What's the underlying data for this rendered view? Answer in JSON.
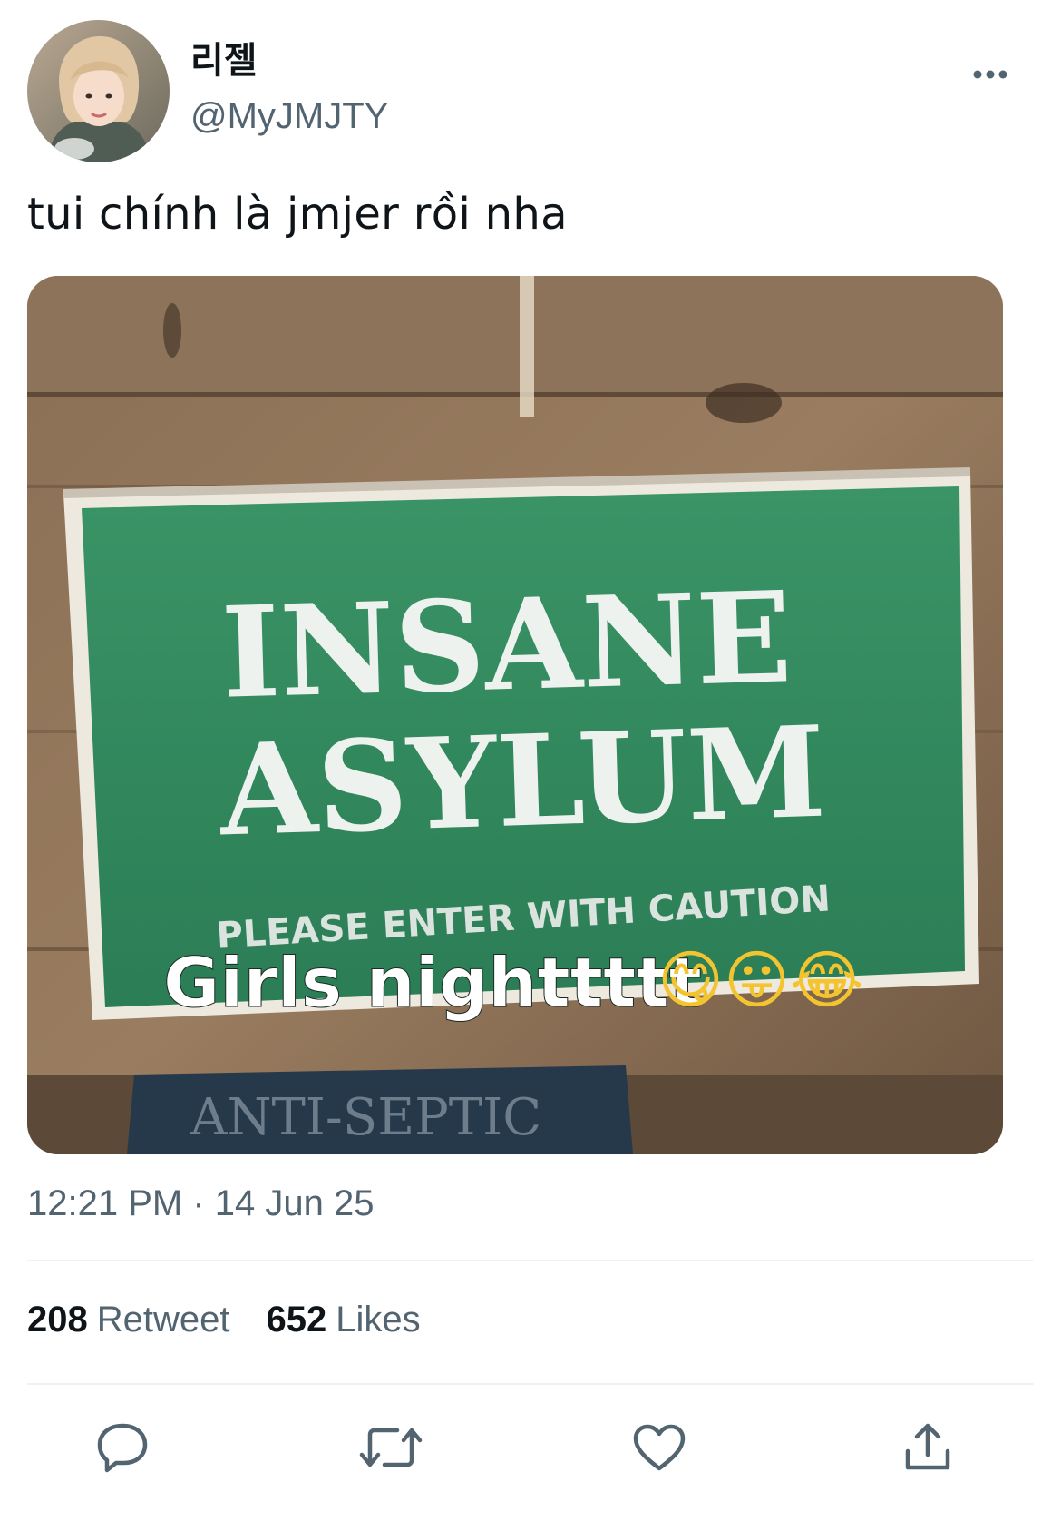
{
  "user": {
    "display_name": "리젤",
    "handle": "@MyJMJTY"
  },
  "tweet": {
    "text": "tui chính là jmjer rồi nha",
    "timestamp": "12:21 PM · 14 Jun 25"
  },
  "media": {
    "sign_line1": "INSANE",
    "sign_line2": "ASYLUM",
    "sign_subtitle": "PLEASE ENTER WITH CAUTION",
    "overlay_caption": "Girls nighttttt",
    "overlay_emojis": "😋😛😂",
    "lower_sign_text": "ANTI-SEPTIC"
  },
  "stats": {
    "retweets_count": "208",
    "retweets_label": "Retweet",
    "likes_count": "652",
    "likes_label": "Likes"
  },
  "icons": {
    "more": "more-horizontal-icon",
    "reply": "reply-bubble-icon",
    "retweet": "retweet-arrows-icon",
    "like": "heart-icon",
    "share": "share-upload-icon"
  },
  "colors": {
    "primary_text": "#0f1419",
    "secondary_text": "#536471",
    "divider": "#eff3f4",
    "sign_green": "#2f8a5e"
  }
}
